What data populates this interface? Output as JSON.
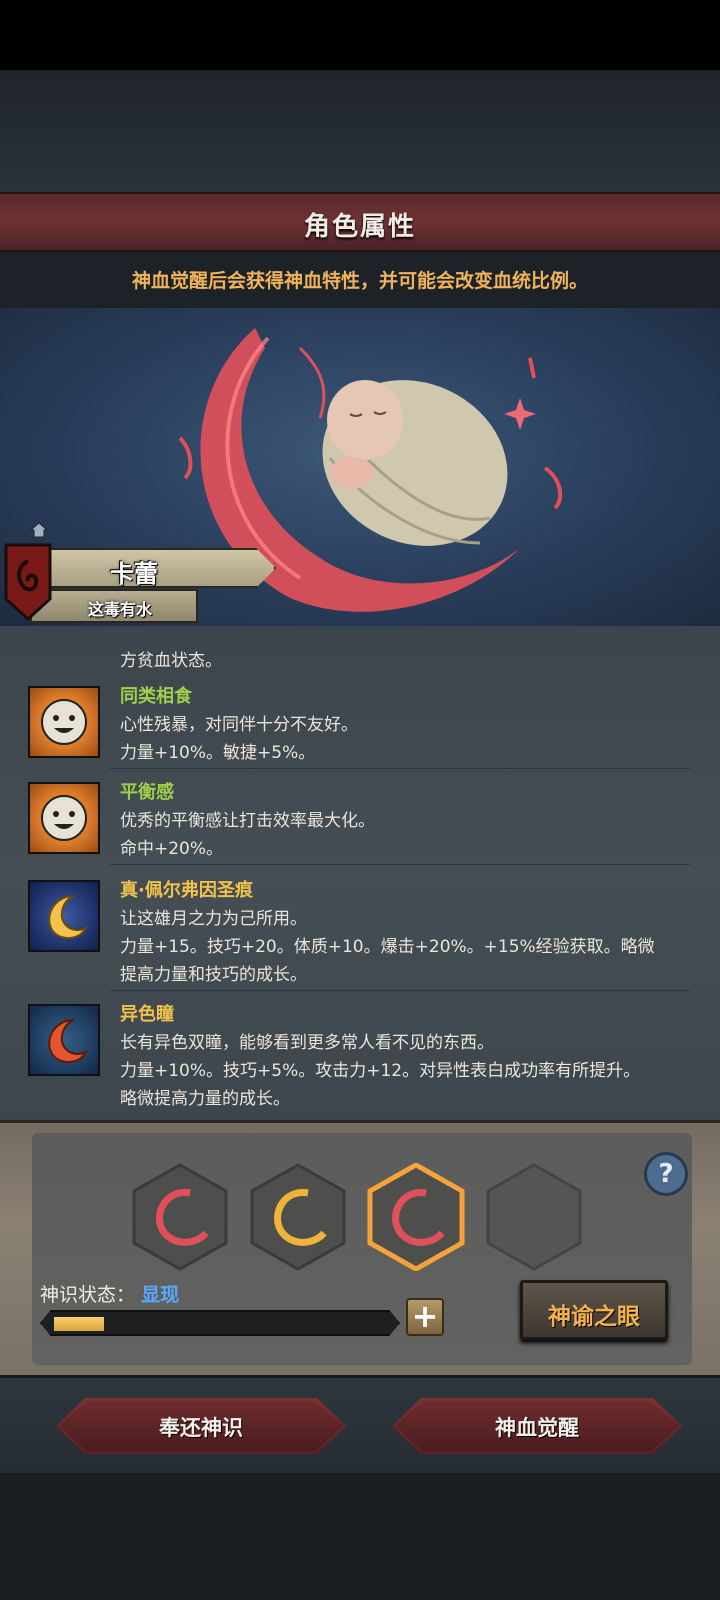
{
  "header": {
    "title": "角色属性"
  },
  "hint": "神血觉醒后会获得神血特性，并可能会改变血统比例。",
  "character": {
    "name": "卡蕾",
    "subtitle": "这毒有水"
  },
  "traits_partial": {
    "line": "方贫血状态。"
  },
  "traits": [
    {
      "name": "同类相食",
      "icon": "smiley-sun-icon",
      "name_color": "#9fd04a",
      "lines": [
        "心性残暴，对同伴十分不友好。",
        "力量+10%。敏捷+5%。"
      ]
    },
    {
      "name": "平衡感",
      "icon": "smiley-sun-icon",
      "name_color": "#9fd04a",
      "lines": [
        "优秀的平衡感让打击效率最大化。",
        "命中+20%。"
      ]
    },
    {
      "name": "真·佩尔弗因圣痕",
      "icon": "golden-moon-icon",
      "name_color": "#f0c24a",
      "lines": [
        "让这雄月之力为己所用。",
        "力量+15。技巧+20。体质+10。爆击+20%。+15%经验获取。略微",
        "提高力量和技巧的成长。"
      ]
    },
    {
      "name": "异色瞳",
      "icon": "red-moon-icon",
      "name_color": "#f0c24a",
      "lines": [
        "长有异色双瞳，能够看到更多常人看不见的东西。",
        "力量+10%。技巧+5%。攻击力+12。对异性表白成功率有所提升。",
        "略微提高力量的成长。"
      ]
    }
  ],
  "god_panel": {
    "slots": [
      "red-sigil-icon",
      "gold-sigil-icon",
      "red-sigil-selected-icon",
      "empty-slot"
    ],
    "help": "?",
    "status_label": "神识状态：",
    "status_value": "显现",
    "progress": 0.15,
    "plus": "+",
    "oracle_button": "神谕之眼"
  },
  "buttons": {
    "return": "奉还神识",
    "awaken": "神血觉醒"
  },
  "colors": {
    "accent_red": "#6e3234",
    "hint_orange": "#f0b25a",
    "status_blue": "#5aa7ff",
    "trait_green": "#9fd04a",
    "trait_gold": "#f0c24a"
  }
}
